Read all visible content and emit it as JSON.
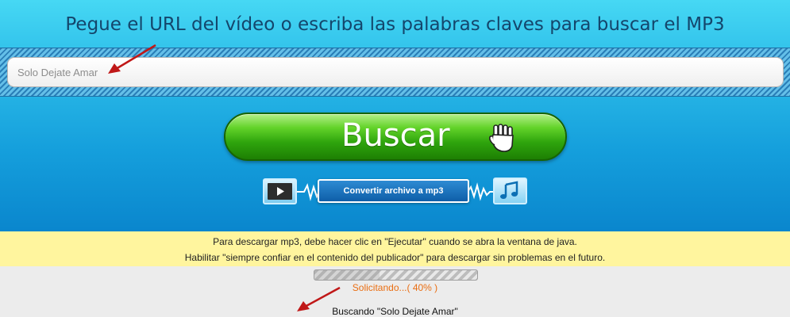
{
  "header": {
    "title": "Pegue el URL del vídeo o escriba las palabras claves para buscar el MP3"
  },
  "search": {
    "value": "Solo Dejate Amar"
  },
  "buttons": {
    "buscar_label": "Buscar",
    "convert_label": "Convertir archivo a mp3"
  },
  "icons": {
    "buscar": "hand-icon",
    "video": "video-play-icon",
    "music": "music-note-icon",
    "annotation": "red-arrow-icon"
  },
  "notice": {
    "line1": "Para descargar mp3, debe hacer clic en \"Ejecutar\" cuando se abra la ventana de java.",
    "line2": "Habilitar \"siempre confiar en el contenido del publicador\" para descargar sin problemas en el futuro."
  },
  "progress": {
    "value": 0.4,
    "text": "Solicitando...( 40% )"
  },
  "status": {
    "searching": "Buscando \"Solo Dejate Amar\""
  },
  "colors": {
    "background_top": "#46d8f4",
    "background_bottom": "#0a86cd",
    "heading": "#14466c",
    "button_green": "#2fa50d",
    "notice_bg": "#fff59e",
    "progress_text": "#ea6e12",
    "arrow": "#c01818"
  }
}
